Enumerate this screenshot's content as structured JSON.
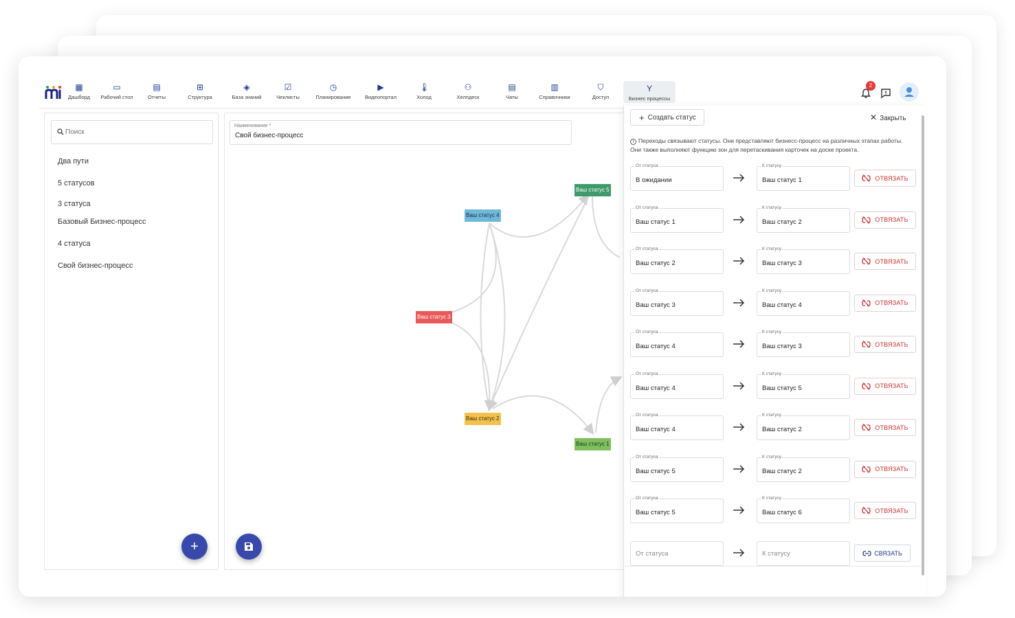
{
  "nav": {
    "items": [
      {
        "label": "Дашборд",
        "icon": "dashboard-icon",
        "glyph": "▦"
      },
      {
        "label": "Рабочий стол",
        "icon": "laptop-icon",
        "glyph": "▭"
      },
      {
        "label": "Отчеты",
        "icon": "report-icon",
        "glyph": "▤"
      },
      {
        "label": "Структура",
        "icon": "structure-icon",
        "glyph": "⊞"
      },
      {
        "label": "База знаний",
        "icon": "graduation-cap-icon",
        "glyph": "◈"
      },
      {
        "label": "Чеклисты",
        "icon": "checklist-icon",
        "glyph": "☑"
      },
      {
        "label": "Планирование",
        "icon": "clock-icon",
        "glyph": "◷"
      },
      {
        "label": "Видеопортал",
        "icon": "video-icon",
        "glyph": "▶"
      },
      {
        "label": "Холод",
        "icon": "thermometer-icon",
        "glyph": "🌡"
      },
      {
        "label": "Хелпдеск",
        "icon": "helpdesk-icon",
        "glyph": "⚇"
      },
      {
        "label": "Чаты",
        "icon": "chat-icon",
        "glyph": "▤"
      },
      {
        "label": "Справочники",
        "icon": "book-icon",
        "glyph": "▥"
      },
      {
        "label": "Доступ",
        "icon": "shield-icon",
        "glyph": "⛉"
      },
      {
        "label": "Бизнес процессы",
        "icon": "fork-icon",
        "glyph": "Y"
      }
    ],
    "notifications_count": "2"
  },
  "left": {
    "search_placeholder": "Поиск",
    "processes": [
      "Два пути",
      "5 статусов",
      "3 статуса",
      "Базовый Бизнес-процесс",
      "4 статуса",
      "Свой бизнес-процесс"
    ],
    "add_button": "+"
  },
  "center": {
    "name_label": "Наименование *",
    "name_value": "Свой бизнес-процесс",
    "nodes": [
      {
        "label": "Ваш статус 5",
        "color": "#3f9a6b",
        "text_color": "#ffffff"
      },
      {
        "label": "Ваш статус 4",
        "color": "#6fb8d9",
        "text_color": "#1a2a3a"
      },
      {
        "label": "Ваш статус 3",
        "color": "#e85a5a",
        "text_color": "#ffffff"
      },
      {
        "label": "Ваш статус 2",
        "color": "#f2c14e",
        "text_color": "#3a2a00"
      },
      {
        "label": "Ваш статус 1",
        "color": "#7fbf5f",
        "text_color": "#1a3a10"
      }
    ]
  },
  "right": {
    "create_label": "Создать статус",
    "close_label": "Закрыть",
    "info_text": "Переходы связывают статусы. Они представляют бизнесс-процесс на различных этапах работы. Они также выполняют функцию зон для перетаскивания карточек на доске проекта.",
    "from_label": "От статуса",
    "to_label": "К статусу",
    "unlink_label": "ОТВЯЗАТЬ",
    "link_label": "СВЯЗАТЬ",
    "transitions": [
      {
        "from": "В ожидании",
        "to": "Ваш статус 1"
      },
      {
        "from": "Ваш статус 1",
        "to": "Ваш статус 2"
      },
      {
        "from": "Ваш статус 2",
        "to": "Ваш статус 3"
      },
      {
        "from": "Ваш статус 3",
        "to": "Ваш статус 4"
      },
      {
        "from": "Ваш статус 4",
        "to": "Ваш статус 3"
      },
      {
        "from": "Ваш статус 4",
        "to": "Ваш статус 5"
      },
      {
        "from": "Ваш статус 4",
        "to": "Ваш статус 2"
      },
      {
        "from": "Ваш статус 5",
        "to": "Ваш статус 2"
      },
      {
        "from": "Ваш статус 5",
        "to": "Ваш статус 6"
      }
    ],
    "new_from_placeholder": "От статуса",
    "new_to_placeholder": "К статусу"
  },
  "colors": {
    "accent": "#3949ab",
    "danger": "#d32f2f",
    "badge": "#e53935"
  }
}
